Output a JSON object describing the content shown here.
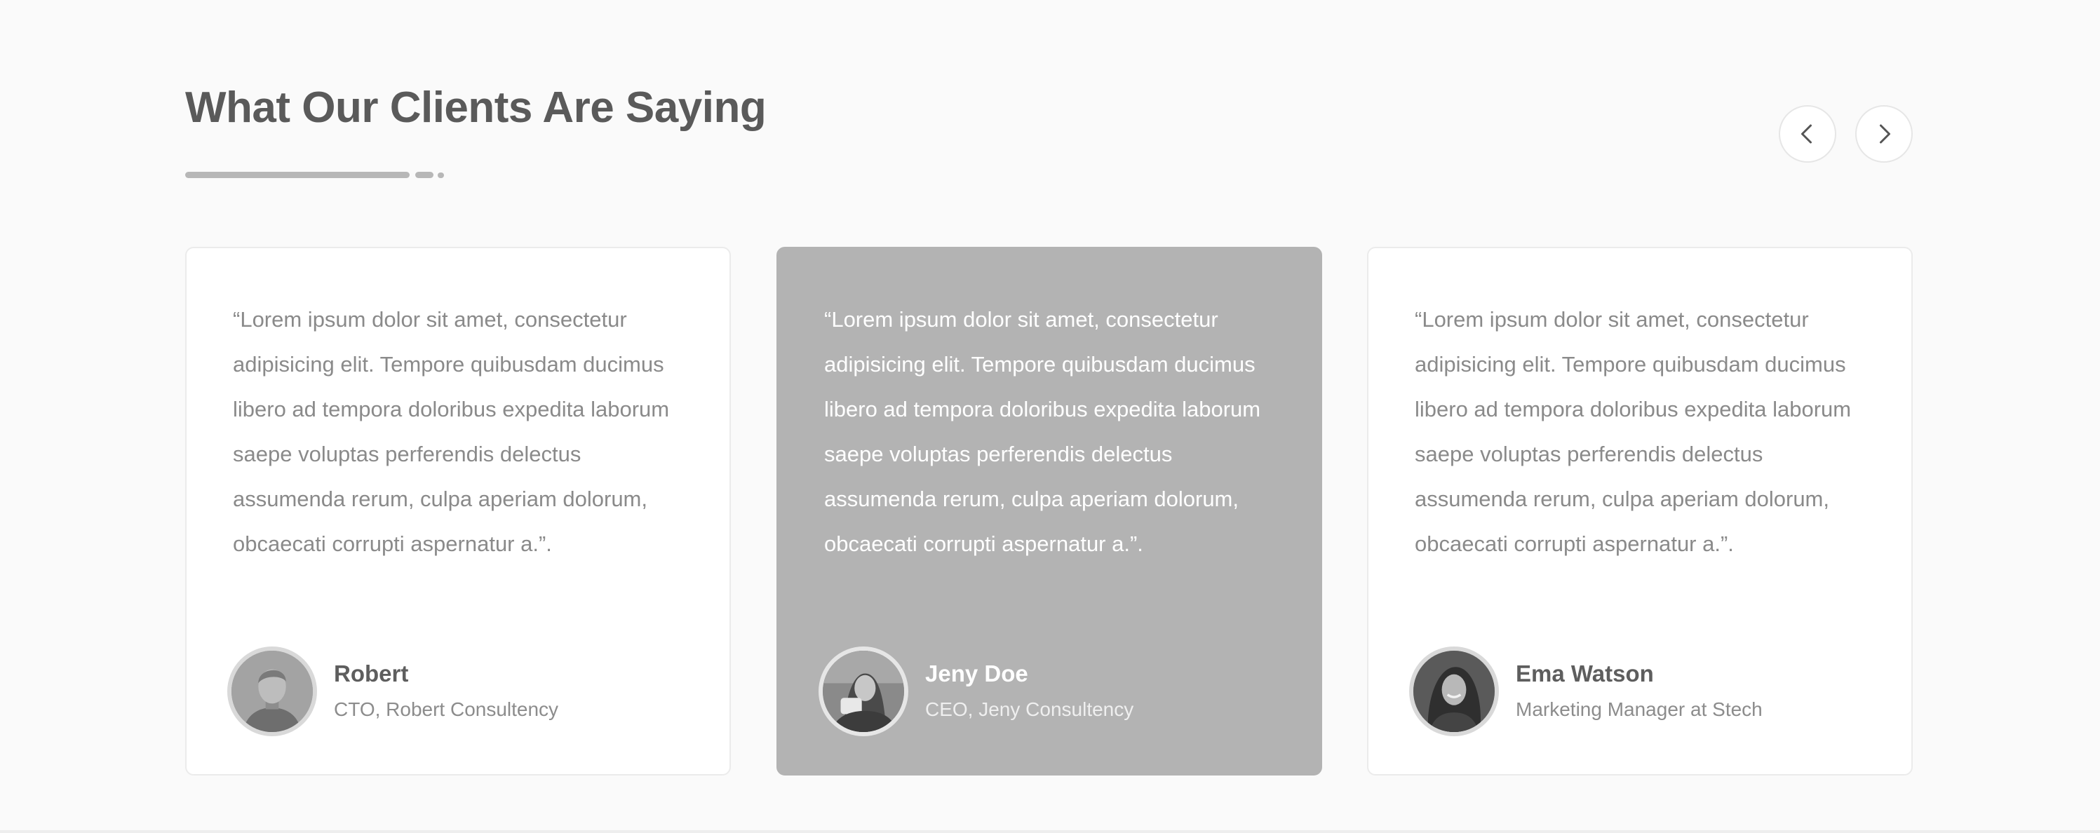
{
  "section": {
    "title": "What Our Clients Are Saying"
  },
  "carousel": {
    "prev_icon": "chevron-left-icon",
    "next_icon": "chevron-right-icon"
  },
  "testimonials": [
    {
      "quote": "“Lorem ipsum dolor sit amet, consectetur adipisicing elit. Tempore quibusdam ducimus libero ad tempora doloribus expedita laborum saepe voluptas perferendis delectus assumenda rerum, culpa aperiam dolorum, obcaecati corrupti aspernatur a.”.",
      "name": "Robert",
      "role": "CTO, Robert Consultency",
      "highlighted": false
    },
    {
      "quote": "“Lorem ipsum dolor sit amet, consectetur adipisicing elit. Tempore quibusdam ducimus libero ad tempora doloribus expedita laborum saepe voluptas perferendis delectus assumenda rerum, culpa aperiam dolorum, obcaecati corrupti aspernatur a.”.",
      "name": "Jeny Doe",
      "role": "CEO, Jeny Consultency",
      "highlighted": true
    },
    {
      "quote": "“Lorem ipsum dolor sit amet, consectetur adipisicing elit. Tempore quibusdam ducimus libero ad tempora doloribus expedita laborum saepe voluptas perferendis delectus assumenda rerum, culpa aperiam dolorum, obcaecati corrupti aspernatur a.”.",
      "name": "Ema Watson",
      "role": "Marketing Manager at Stech",
      "highlighted": false
    }
  ],
  "colors": {
    "title": "#5a5a5a",
    "highlight_card": "#b3b3b3",
    "card_border": "#ebebeb",
    "body_text": "#8a8a8a"
  }
}
